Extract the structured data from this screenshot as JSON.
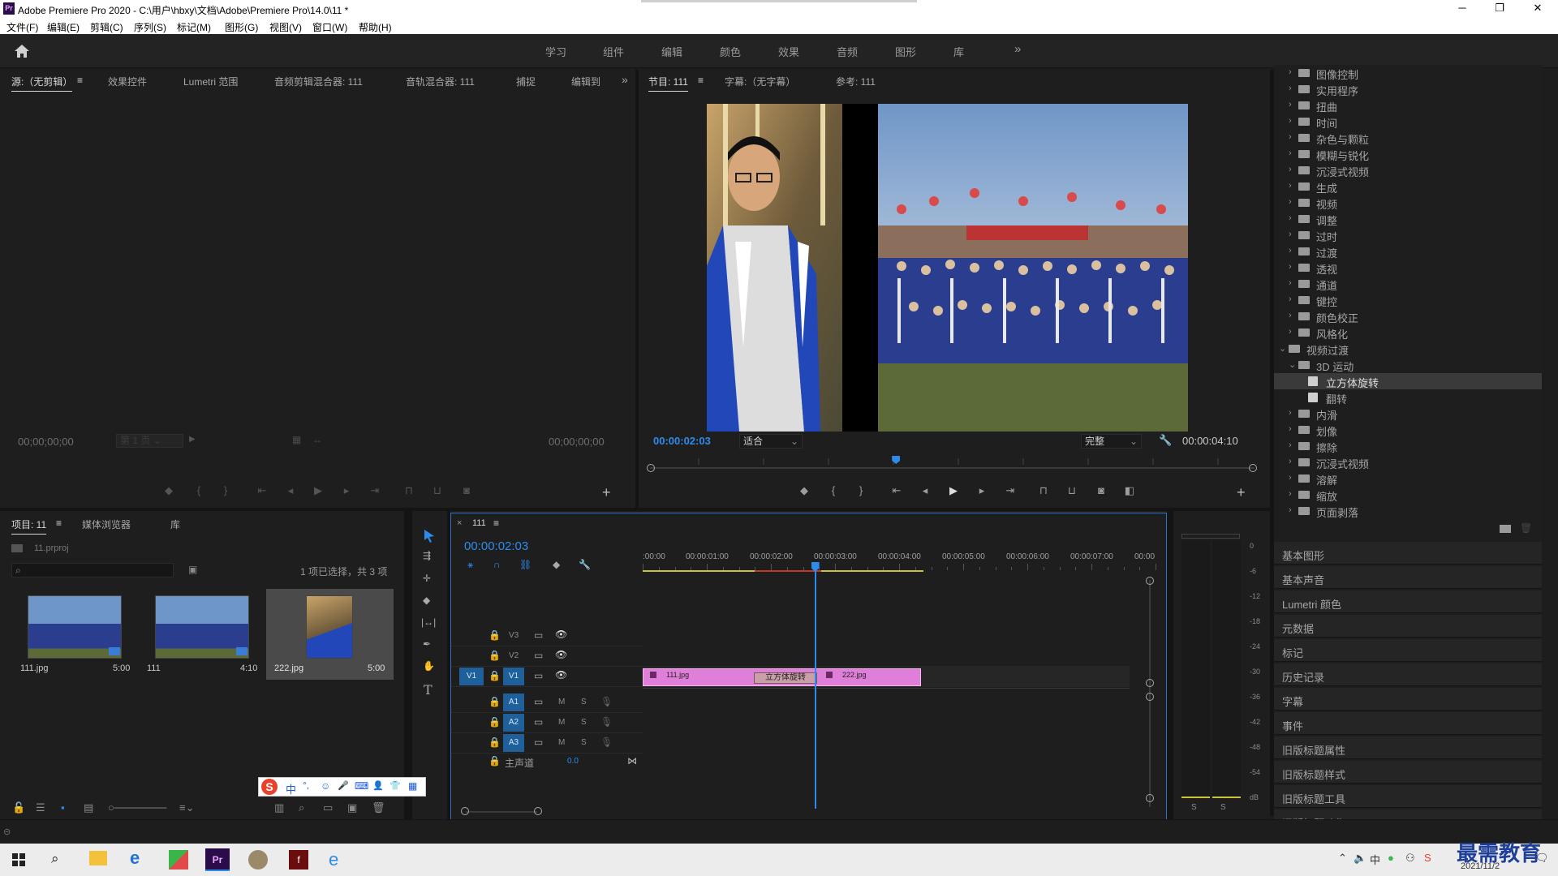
{
  "window": {
    "title": "Adobe Premiere Pro 2020 - C:\\用户\\hbxy\\文档\\Adobe\\Premiere Pro\\14.0\\11 *",
    "app_icon": "Pr",
    "controls": [
      "─",
      "❐",
      "✕"
    ]
  },
  "menu": [
    "文件(F)",
    "编辑(E)",
    "剪辑(C)",
    "序列(S)",
    "标记(M)",
    "图形(G)",
    "视图(V)",
    "窗口(W)",
    "帮助(H)"
  ],
  "workspaces": [
    "学习",
    "组件",
    "编辑",
    "颜色",
    "效果",
    "音频",
    "图形",
    "库"
  ],
  "workspaces_more": "»",
  "source_panel": {
    "tabs": [
      "源:（无剪辑）",
      "效果控件",
      "Lumetri 范围",
      "音频剪辑混合器: 111",
      "音轨混合器: 111",
      "捕捉",
      "编辑到"
    ],
    "menu_icon": "≡",
    "more": "»",
    "timecode_left": "00;00;00;00",
    "page_select": "第 1 页",
    "timecode_right": "00;00;00;00",
    "add": "+"
  },
  "program_panel": {
    "tabs": [
      "节目: 111",
      "字幕:（无字幕）",
      "参考: 111"
    ],
    "menu_icon": "≡",
    "timecode": "00:00:02:03",
    "fit": "适合",
    "quality": "完整",
    "duration": "00:00:04:10",
    "add": "+"
  },
  "effects_tree": [
    {
      "label": "图像控制",
      "level": 1,
      "open": false
    },
    {
      "label": "实用程序",
      "level": 1,
      "open": false
    },
    {
      "label": "扭曲",
      "level": 1,
      "open": false
    },
    {
      "label": "时间",
      "level": 1,
      "open": false
    },
    {
      "label": "杂色与颗粒",
      "level": 1,
      "open": false
    },
    {
      "label": "模糊与锐化",
      "level": 1,
      "open": false
    },
    {
      "label": "沉浸式视频",
      "level": 1,
      "open": false
    },
    {
      "label": "生成",
      "level": 1,
      "open": false
    },
    {
      "label": "视频",
      "level": 1,
      "open": false
    },
    {
      "label": "调整",
      "level": 1,
      "open": false
    },
    {
      "label": "过时",
      "level": 1,
      "open": false
    },
    {
      "label": "过渡",
      "level": 1,
      "open": false
    },
    {
      "label": "透视",
      "level": 1,
      "open": false
    },
    {
      "label": "通道",
      "level": 1,
      "open": false
    },
    {
      "label": "键控",
      "level": 1,
      "open": false
    },
    {
      "label": "颜色校正",
      "level": 1,
      "open": false
    },
    {
      "label": "风格化",
      "level": 1,
      "open": false
    },
    {
      "label": "视频过渡",
      "level": 0,
      "open": true
    },
    {
      "label": "3D 运动",
      "level": 1,
      "open": true
    },
    {
      "label": "立方体旋转",
      "level": 2,
      "item": true,
      "selected": true
    },
    {
      "label": "翻转",
      "level": 2,
      "item": true
    },
    {
      "label": "内滑",
      "level": 1,
      "open": false
    },
    {
      "label": "划像",
      "level": 1,
      "open": false
    },
    {
      "label": "擦除",
      "level": 1,
      "open": false
    },
    {
      "label": "沉浸式视频",
      "level": 1,
      "open": false
    },
    {
      "label": "溶解",
      "level": 1,
      "open": false
    },
    {
      "label": "缩放",
      "level": 1,
      "open": false
    },
    {
      "label": "页面剥落",
      "level": 1,
      "open": false
    }
  ],
  "side_panels": [
    "基本图形",
    "基本声音",
    "Lumetri 颜色",
    "元数据",
    "标记",
    "历史记录",
    "字幕",
    "事件",
    "旧版标题属性",
    "旧版标题样式",
    "旧版标题工具",
    "旧版标题动作"
  ],
  "project_panel": {
    "tabs": [
      "项目: 11",
      "媒体浏览器",
      "库"
    ],
    "menu_icon": "≡",
    "file": "11.prproj",
    "selection_info": "1 项已选择，共 3 项",
    "items": [
      {
        "name": "111.jpg",
        "duration": "5:00"
      },
      {
        "name": "111",
        "duration": "4:10"
      },
      {
        "name": "222.jpg",
        "duration": "5:00"
      }
    ]
  },
  "ime_toolbar": {
    "logo": "S",
    "lang": "中",
    "punct": "°,",
    "icons": [
      "☺",
      "🎤",
      "⌨",
      "👤",
      "👕",
      "▦"
    ]
  },
  "timeline": {
    "close": "×",
    "name": "111",
    "menu_icon": "≡",
    "timecode": "00:00:02:03",
    "ruler": [
      ":00:00",
      "00:00:01:00",
      "00:00:02:00",
      "00:00:03:00",
      "00:00:04:00",
      "00:00:05:00",
      "00:00:06:00",
      "00:00:07:00",
      "00:00"
    ],
    "video_tracks": [
      "V3",
      "V2",
      "V1"
    ],
    "audio_tracks": [
      "A1",
      "A2",
      "A3"
    ],
    "source_patch_v": "V1",
    "mute_label": "M",
    "solo_label": "S",
    "master_label": "主声道",
    "master_value": "0.0",
    "clips": [
      {
        "name": "111.jpg"
      },
      {
        "name": "立方体旋转"
      },
      {
        "name": "222.jpg"
      }
    ],
    "playhead_fraction": 0.407
  },
  "audio_meter": {
    "scale": [
      "0",
      "-6",
      "-12",
      "-18",
      "-24",
      "-30",
      "-36",
      "-42",
      "-48",
      "-54",
      "dB"
    ],
    "solo": [
      "S",
      "S"
    ]
  },
  "taskbar": {
    "date": "2021/11/2",
    "watermark": "最需教育"
  },
  "colors": {
    "accent": "#2d8ceb",
    "clip": "#e07fd9",
    "transition": "#c9a0a8",
    "timeline_border": "#2f73c9"
  }
}
